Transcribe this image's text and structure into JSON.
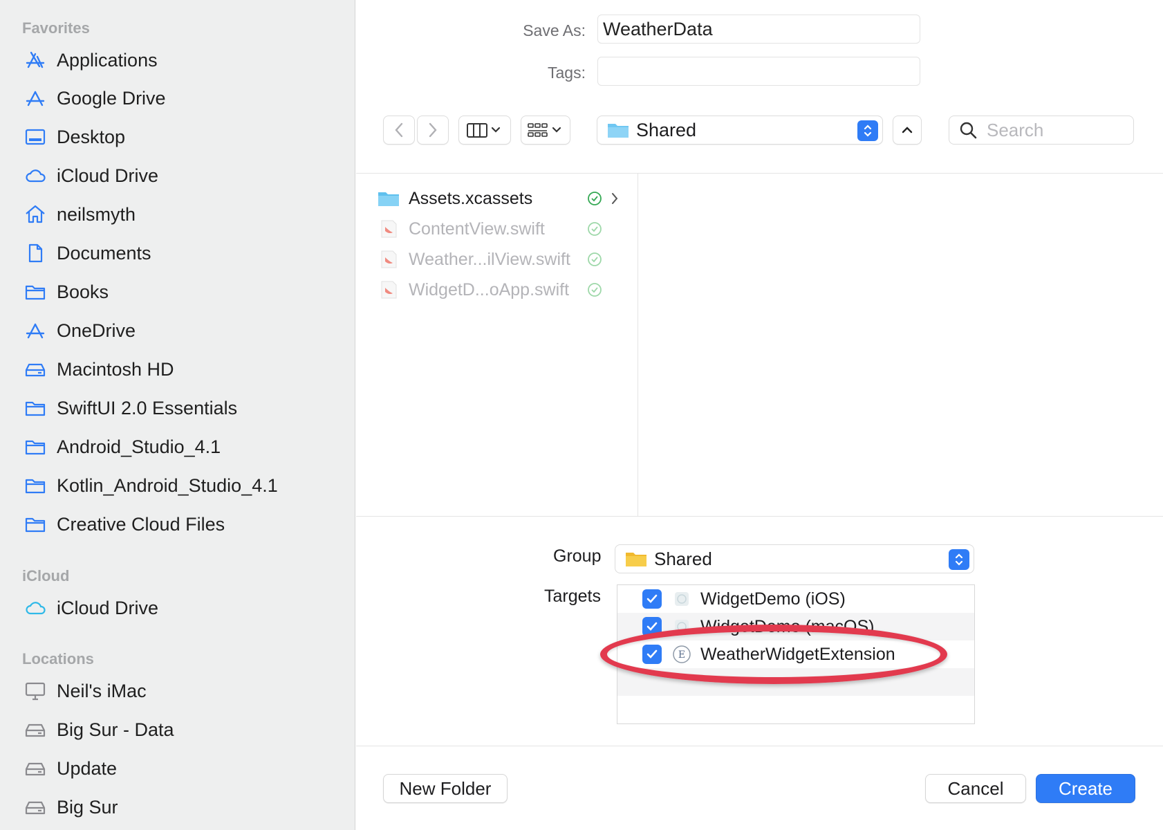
{
  "sidebar": {
    "favorites_header": "Favorites",
    "favorites": [
      {
        "label": "Applications",
        "icon": "applications-icon"
      },
      {
        "label": "Google Drive",
        "icon": "applications-icon"
      },
      {
        "label": "Desktop",
        "icon": "desktop-icon"
      },
      {
        "label": "iCloud Drive",
        "icon": "cloud-icon"
      },
      {
        "label": "neilsmyth",
        "icon": "home-icon"
      },
      {
        "label": "Documents",
        "icon": "document-icon"
      },
      {
        "label": "Books",
        "icon": "folder-icon"
      },
      {
        "label": "OneDrive",
        "icon": "applications-icon"
      },
      {
        "label": "Macintosh HD",
        "icon": "drive-icon"
      },
      {
        "label": "SwiftUI 2.0 Essentials",
        "icon": "folder-icon"
      },
      {
        "label": "Android_Studio_4.1",
        "icon": "folder-icon"
      },
      {
        "label": "Kotlin_Android_Studio_4.1",
        "icon": "folder-icon"
      },
      {
        "label": "Creative Cloud Files",
        "icon": "folder-icon"
      }
    ],
    "icloud_header": "iCloud",
    "icloud": [
      {
        "label": "iCloud Drive",
        "icon": "cloud-icon"
      }
    ],
    "locations_header": "Locations",
    "locations": [
      {
        "label": "Neil's iMac",
        "icon": "computer-icon"
      },
      {
        "label": "Big Sur - Data",
        "icon": "drive-icon"
      },
      {
        "label": "Update",
        "icon": "drive-icon"
      },
      {
        "label": "Big Sur",
        "icon": "drive-icon"
      }
    ]
  },
  "form": {
    "save_as_label": "Save As:",
    "save_as_value": "WeatherData",
    "tags_label": "Tags:",
    "tags_value": ""
  },
  "toolbar": {
    "location": "Shared",
    "search_placeholder": "Search"
  },
  "files": [
    {
      "name": "Assets.xcassets",
      "type": "folder",
      "enabled": true,
      "has_children": true
    },
    {
      "name": "ContentView.swift",
      "type": "swift",
      "enabled": false,
      "has_children": false
    },
    {
      "name": "Weather...ilView.swift",
      "type": "swift",
      "enabled": false,
      "has_children": false
    },
    {
      "name": "WidgetD...oApp.swift",
      "type": "swift",
      "enabled": false,
      "has_children": false
    }
  ],
  "group": {
    "label": "Group",
    "value": "Shared"
  },
  "targets": {
    "label": "Targets",
    "items": [
      {
        "name": "WidgetDemo (iOS)",
        "checked": true,
        "icon": "app-target-icon"
      },
      {
        "name": "WidgetDemo (macOS)",
        "checked": true,
        "icon": "app-target-icon"
      },
      {
        "name": "WeatherWidgetExtension",
        "checked": true,
        "icon": "extension-target-icon"
      }
    ]
  },
  "buttons": {
    "new_folder": "New Folder",
    "cancel": "Cancel",
    "create": "Create"
  },
  "colors": {
    "accent": "#2f7cf6",
    "highlight": "#e23a4e",
    "sidebar_bg": "#eeefef",
    "check_green": "#34a853"
  }
}
